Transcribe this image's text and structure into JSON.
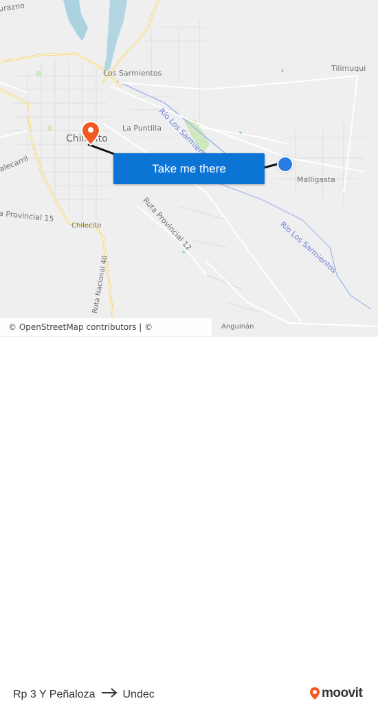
{
  "map": {
    "labels": {
      "durazno": "urazno",
      "los_sarmientos": "Los Sarmientos",
      "tilimuqui": "Tilimuqui",
      "la_puntilla": "La Puntilla",
      "chilecito_city": "Chilecito",
      "malligasta": "Malligasta",
      "ruta_provincial_12": "Ruta Provincial 12",
      "ruta_provincial_15": "a Provincial 15",
      "chilecito_small": "Chilecito",
      "ruta_nacional_40": "Ruta Nacional 40",
      "anguinan": "Anguinán",
      "rio_los_sarmientos_1": "Río Los Sarmientos",
      "rio_los_sarmientos_2": "Río Los Sarmientos",
      "alecarril": "alecarril"
    },
    "origin_color": "#2a7de1",
    "destination_color": "#f05a22",
    "water_color": "#aad3df",
    "road_major_color": "#f7e6a1"
  },
  "cta_label": "Take me there",
  "attribution": "© OpenStreetMap contributors | © OpenMapTiles",
  "route": {
    "from": "Rp 3 Y Peñaloza",
    "to": "Undec"
  },
  "brand": {
    "name": "moovit",
    "color": "#f05a22"
  }
}
